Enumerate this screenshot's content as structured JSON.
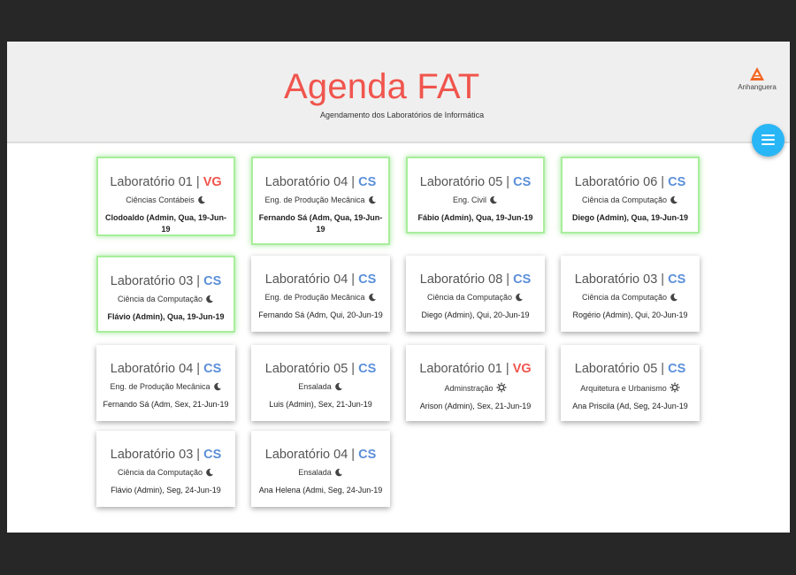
{
  "header": {
    "title": "Agenda FAT",
    "subtitle": "Agendamento dos Laboratórios de Informática",
    "logo_text": "Anhanguera"
  },
  "colors": {
    "title": "#f0554d",
    "vg": "#f0554d",
    "cs": "#5b8fd9",
    "active_border": "#a8ee9b",
    "menu_button": "#29b6f6"
  },
  "cards": [
    {
      "lab": "Laboratório 01",
      "sep": " | ",
      "code": "VG",
      "course": "Ciências Contábeis",
      "shift_icon": "moon-icon",
      "booker": "Clodoaldo (Admin, Qua, 19-Jun-19",
      "active": true
    },
    {
      "lab": "Laboratório 04",
      "sep": " | ",
      "code": "CS",
      "course": "Eng. de Produção Mecânica",
      "shift_icon": "moon-icon",
      "booker": "Fernando Sá (Adm, Qua, 19-Jun-19",
      "active": true
    },
    {
      "lab": "Laboratório 05",
      "sep": " | ",
      "code": "CS",
      "course": "Eng. Civil",
      "shift_icon": "moon-icon",
      "booker": "Fábio (Admin), Qua, 19-Jun-19",
      "active": true
    },
    {
      "lab": "Laboratório 06",
      "sep": " | ",
      "code": "CS",
      "course": "Ciência da Computação",
      "shift_icon": "moon-icon",
      "booker": "Diego (Admin), Qua, 19-Jun-19",
      "active": true
    },
    {
      "lab": "Laboratório 03",
      "sep": " | ",
      "code": "CS",
      "course": "Ciência da Computação",
      "shift_icon": "moon-icon",
      "booker": "Flávio (Admin), Qua, 19-Jun-19",
      "active": true
    },
    {
      "lab": "Laboratório 04",
      "sep": " | ",
      "code": "CS",
      "course": "Eng. de Produção Mecânica",
      "shift_icon": "moon-icon",
      "booker": "Fernando Sá (Adm, Qui, 20-Jun-19",
      "active": false
    },
    {
      "lab": "Laboratório 08",
      "sep": " | ",
      "code": "CS",
      "course": "Ciência da Computação",
      "shift_icon": "moon-icon",
      "booker": "Diego (Admin), Qui, 20-Jun-19",
      "active": false
    },
    {
      "lab": "Laboratório 03",
      "sep": " | ",
      "code": "CS",
      "course": "Ciência da Computação",
      "shift_icon": "moon-icon",
      "booker": "Rogério (Admin), Qui, 20-Jun-19",
      "active": false
    },
    {
      "lab": "Laboratório 04",
      "sep": " | ",
      "code": "CS",
      "course": "Eng. de Produção Mecânica",
      "shift_icon": "moon-icon",
      "booker": "Fernando Sá (Adm, Sex, 21-Jun-19",
      "active": false
    },
    {
      "lab": "Laboratório 05",
      "sep": " | ",
      "code": "CS",
      "course": "Ensalada",
      "shift_icon": "moon-icon",
      "booker": "Luis (Admin), Sex, 21-Jun-19",
      "active": false
    },
    {
      "lab": "Laboratório 01",
      "sep": " | ",
      "code": "VG",
      "course": "Adminstração",
      "shift_icon": "sun-icon",
      "booker": "Arison (Admin), Sex, 21-Jun-19",
      "active": false
    },
    {
      "lab": "Laboratório 05",
      "sep": " | ",
      "code": "CS",
      "course": "Arquitetura e Urbanismo",
      "shift_icon": "sun-icon",
      "booker": "Ana Priscila (Ad, Seg, 24-Jun-19",
      "active": false
    },
    {
      "lab": "Laboratório 03",
      "sep": " | ",
      "code": "CS",
      "course": "Ciência da Computação",
      "shift_icon": "moon-icon",
      "booker": "Flávio (Admin), Seg, 24-Jun-19",
      "active": false
    },
    {
      "lab": "Laboratório 04",
      "sep": " | ",
      "code": "CS",
      "course": "Ensalada",
      "shift_icon": "moon-icon",
      "booker": "Ana Helena (Admi, Seg, 24-Jun-19",
      "active": false
    }
  ]
}
